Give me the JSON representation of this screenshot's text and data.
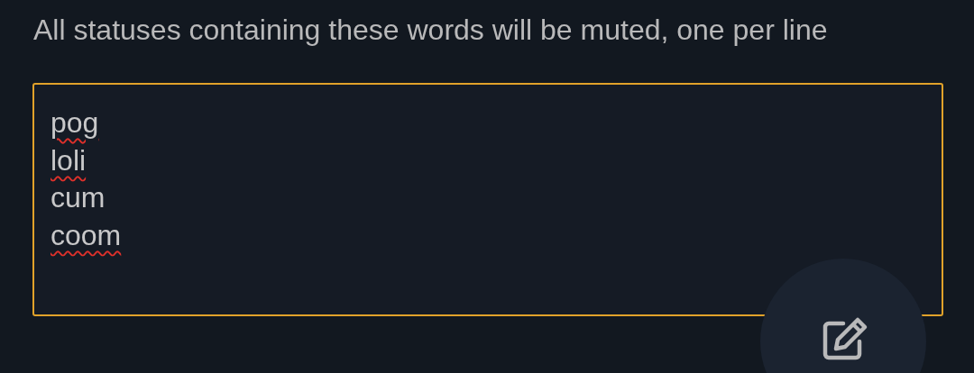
{
  "description": "All statuses containing these words will be muted, one per line",
  "filter_field": {
    "focused": true,
    "lines": [
      {
        "text": "pog",
        "misspelled": true
      },
      {
        "text": "loli",
        "misspelled": true
      },
      {
        "text": "cum",
        "misspelled": false
      },
      {
        "text": "coom",
        "misspelled": true
      }
    ]
  }
}
